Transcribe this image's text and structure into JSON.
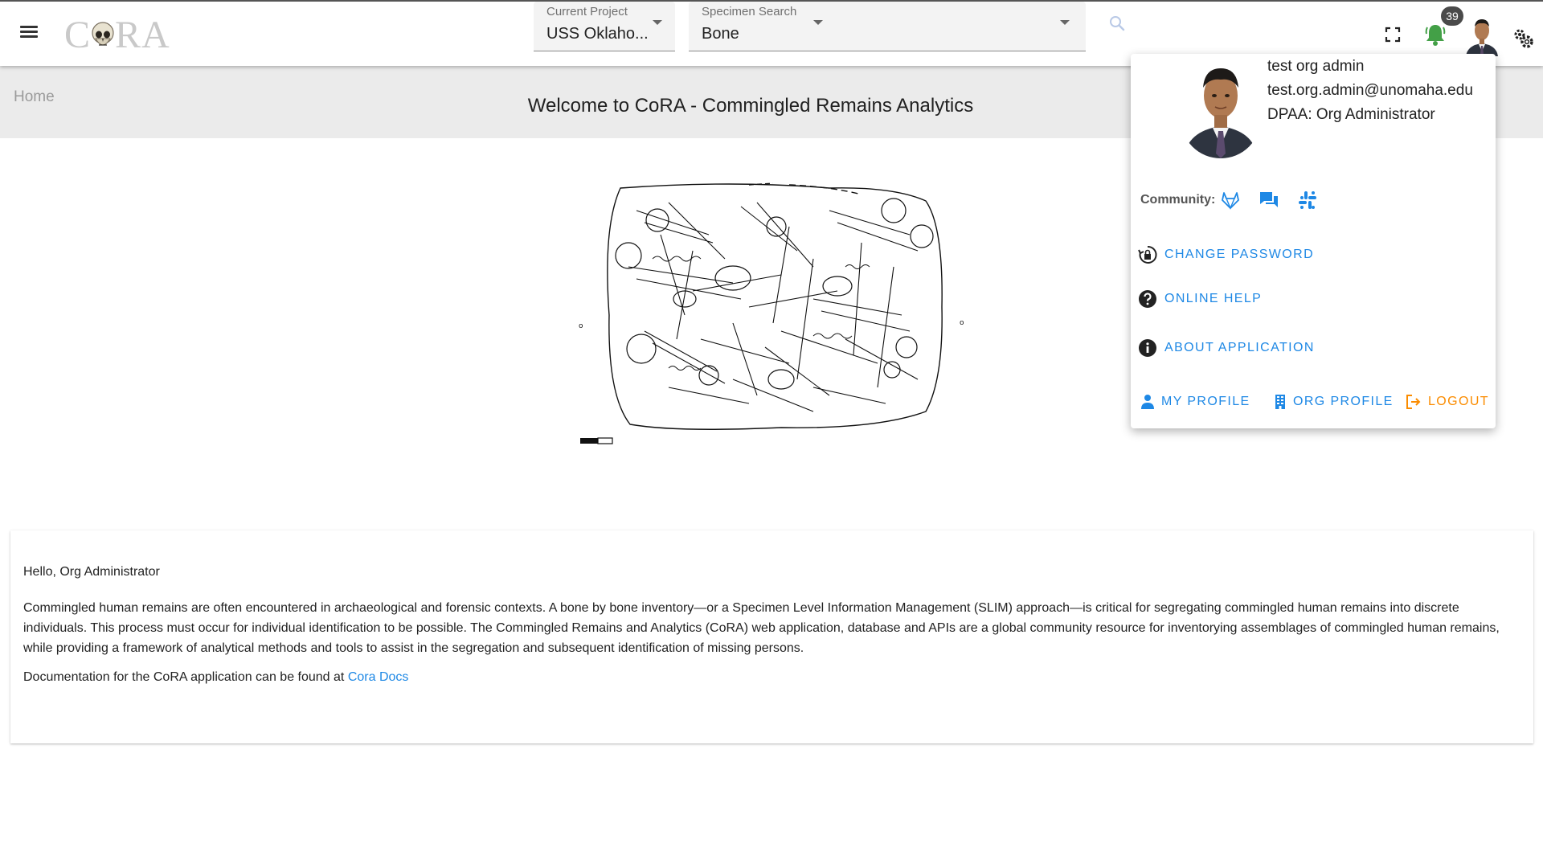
{
  "app": {
    "logo_text_left": "C",
    "logo_text_right": "RA"
  },
  "project_select": {
    "label": "Current Project",
    "value": "USS Oklaho..."
  },
  "specimen_select": {
    "label": "Specimen Search",
    "value": "Bone"
  },
  "notifications": {
    "count": "39"
  },
  "breadcrumb": {
    "home": "Home"
  },
  "page": {
    "title": "Welcome to CoRA - Commingled Remains Analytics"
  },
  "welcome_card": {
    "greeting": "Hello, Org Administrator",
    "intro": "Commingled human remains are often encountered in archaeological and forensic contexts. A bone by bone inventory—or a Specimen Level Information Management (SLIM) approach—is critical for segregating commingled human remains into discrete individuals. This process must occur for individual identification to be possible. The Commingled Remains and Analytics (CoRA) web application, database and APIs are a global community resource for inventorying assemblages of commingled human remains, while providing a framework of analytical methods and tools to assist in the segregation and subsequent identification of missing persons.",
    "docs_prefix": "Documentation for the CoRA application can be found at ",
    "docs_link": "Cora Docs"
  },
  "profile_menu": {
    "name": "test org admin",
    "email": "test.org.admin@unomaha.edu",
    "role": "DPAA: Org Administrator",
    "community_label": "Community:",
    "community_icons": [
      "gitlab-icon",
      "forum-icon",
      "slack-icon"
    ],
    "items": [
      {
        "label": "CHANGE PASSWORD",
        "icon": "lock-reset-icon"
      },
      {
        "label": "ONLINE HELP",
        "icon": "help-circle-icon"
      },
      {
        "label": "ABOUT APPLICATION",
        "icon": "info-circle-icon"
      }
    ],
    "bottom_actions": {
      "my_profile": "MY PROFILE",
      "org_profile": "ORG PROFILE",
      "logout": "LOGOUT"
    }
  },
  "colors": {
    "accent": "#1e88e5",
    "logout": "#fb8c00",
    "bell": "#43a047",
    "header_band": "#ebebeb"
  }
}
